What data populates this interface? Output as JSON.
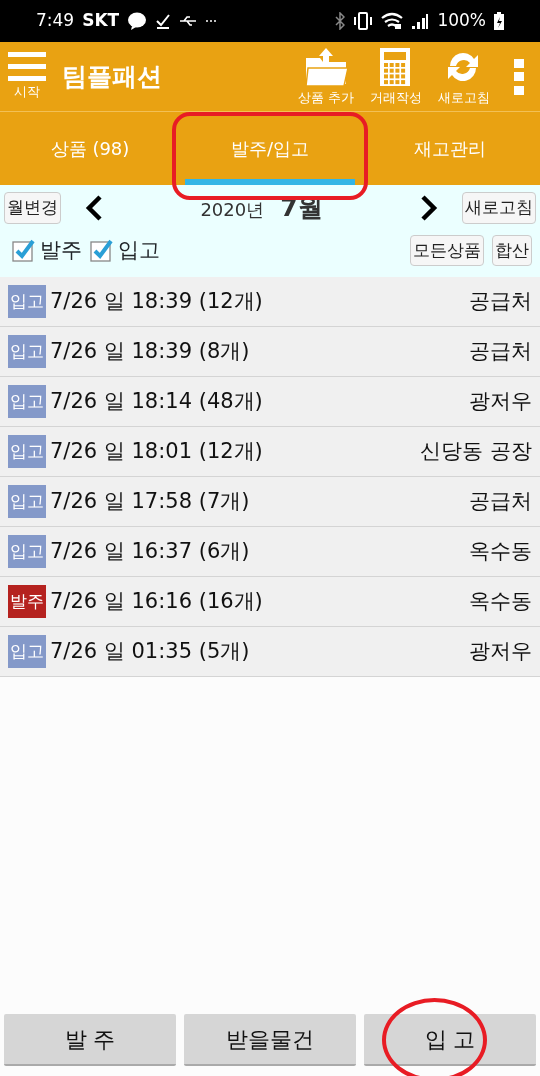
{
  "status_bar": {
    "time": "7:49",
    "carrier": "SKT",
    "battery": "100%"
  },
  "toolbar": {
    "menu_label": "시작",
    "title": "팀플패션",
    "actions": [
      {
        "kind": "folder",
        "label": "상품 추가"
      },
      {
        "kind": "calculator",
        "label": "거래작성"
      },
      {
        "kind": "refresh",
        "label": "새로고침"
      }
    ]
  },
  "tabs": [
    {
      "label": "상품 (98)",
      "selected": false,
      "outlined": false
    },
    {
      "label": "발주/입고",
      "selected": true,
      "outlined": true
    },
    {
      "label": "재고관리",
      "selected": false,
      "outlined": false
    }
  ],
  "month_bar": {
    "change_button": "월변경",
    "year": "2020년",
    "month": "7월",
    "refresh_button": "새로고침"
  },
  "filters": [
    {
      "label": "발주",
      "checked": true
    },
    {
      "label": "입고",
      "checked": true
    }
  ],
  "filter_buttons": [
    "모든상품",
    "합산"
  ],
  "rows": [
    {
      "type": "입고",
      "kind": "in",
      "text": "7/26 일 18:39 (12개)",
      "party": "공급처"
    },
    {
      "type": "입고",
      "kind": "in",
      "text": "7/26 일 18:39 (8개)",
      "party": "공급처"
    },
    {
      "type": "입고",
      "kind": "in",
      "text": "7/26 일 18:14 (48개)",
      "party": "광저우"
    },
    {
      "type": "입고",
      "kind": "in",
      "text": "7/26 일 18:01 (12개)",
      "party": "신당동 공장"
    },
    {
      "type": "입고",
      "kind": "in",
      "text": "7/26 일 17:58 (7개)",
      "party": "공급처"
    },
    {
      "type": "입고",
      "kind": "in",
      "text": "7/26 일 16:37 (6개)",
      "party": "옥수동"
    },
    {
      "type": "발주",
      "kind": "order",
      "text": "7/26 일 16:16 (16개)",
      "party": "옥수동"
    },
    {
      "type": "입고",
      "kind": "in",
      "text": "7/26 일 01:35 (5개)",
      "party": "광저우"
    }
  ],
  "bottom_buttons": [
    {
      "label": "발 주",
      "circled": false
    },
    {
      "label": "받을물건",
      "circled": false
    },
    {
      "label": "입 고",
      "circled": true
    }
  ]
}
